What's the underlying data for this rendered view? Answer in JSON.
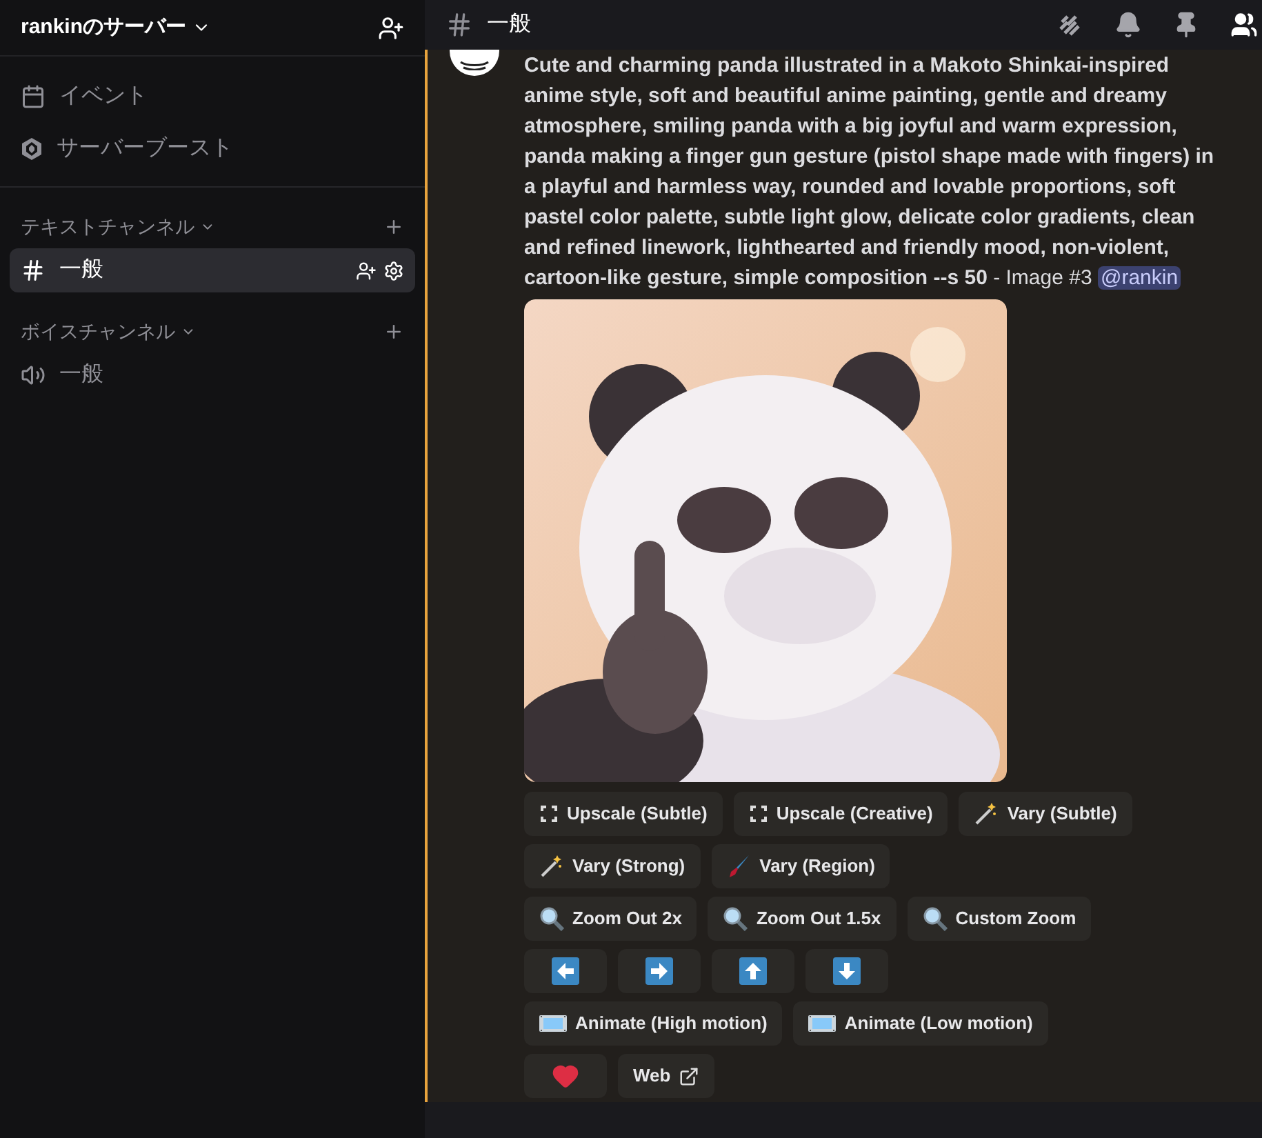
{
  "server": {
    "name": "rankinのサーバー"
  },
  "sidebar": {
    "items": [
      {
        "label": "イベント",
        "kind": "event"
      },
      {
        "label": "サーバーブースト",
        "kind": "boost"
      }
    ],
    "categories": [
      {
        "name": "テキストチャンネル",
        "channels": [
          {
            "name": "一般",
            "kind": "text",
            "selected": true
          }
        ]
      },
      {
        "name": "ボイスチャンネル",
        "channels": [
          {
            "name": "一般",
            "kind": "voice",
            "selected": false
          }
        ]
      }
    ]
  },
  "channel_header": {
    "name": "一般"
  },
  "message": {
    "text": "**Cute and charming panda illustrated in a Makoto Shinkai-inspired anime style, soft and beautiful anime painting, gentle and dreamy atmosphere, smiling panda with a big joyful and warm expression, panda making a finger gun gesture (pistol shape made with fingers) in a playful and harmless way, rounded and lovable proportions, soft pastel color palette, subtle light glow, delicate color gradients, clean and refined linework, lighthearted and friendly mood, non-violent, cartoon-like gesture, simple composition --s 50** - Image #3",
    "mention": "@rankin",
    "image": {
      "kind": "picture"
    },
    "button_rows": [
      [
        {
          "label": "Upscale (Subtle)",
          "kind": "upscale"
        },
        {
          "label": "Upscale (Creative)",
          "kind": "upscale"
        },
        {
          "label": "Vary (Subtle)",
          "kind": "wand"
        }
      ],
      [
        {
          "label": "Vary (Strong)",
          "kind": "wand"
        },
        {
          "label": "Vary (Region)",
          "kind": "brush"
        }
      ],
      [
        {
          "label": "Zoom Out 2x",
          "kind": "zoom"
        },
        {
          "label": "Zoom Out 1.5x",
          "kind": "zoom"
        },
        {
          "label": "Custom Zoom",
          "kind": "zoom"
        }
      ],
      [
        {
          "kind": "left"
        },
        {
          "kind": "right"
        },
        {
          "kind": "up"
        },
        {
          "kind": "down"
        }
      ],
      [
        {
          "label": "Animate (High motion)",
          "kind": "film"
        },
        {
          "label": "Animate (Low motion)",
          "kind": "film"
        }
      ],
      [
        {
          "kind": "heart"
        },
        {
          "label": "Web",
          "kind": "external"
        }
      ]
    ]
  }
}
